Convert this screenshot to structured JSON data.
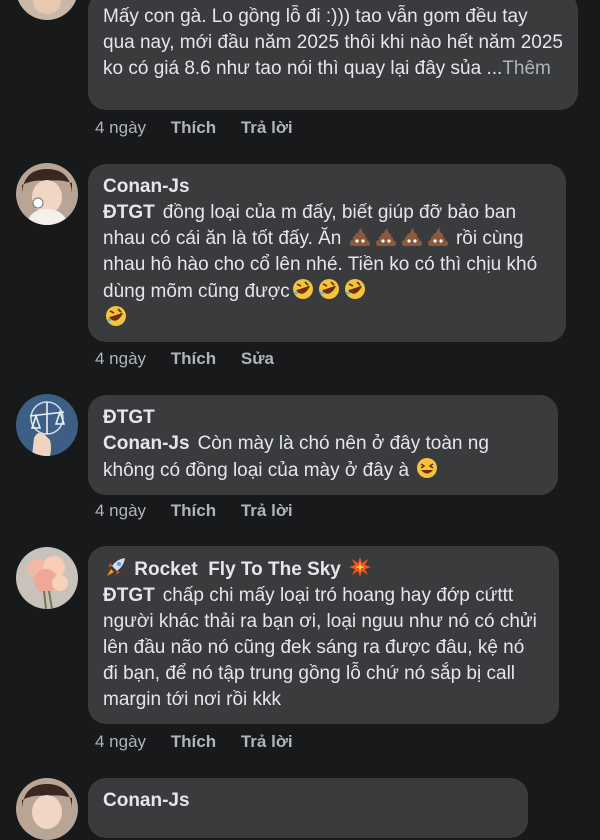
{
  "comments": [
    {
      "text": "Mấy con gà. Lo gồng lỗ đi :))) tao vẫn gom đều tay qua nay, mới đầu năm 2025 thôi khi nào hết năm 2025 ko có giá 8.6 như tao nói thì quay lại đây sủa ...",
      "see_more": "Thêm",
      "time": "4 ngày",
      "like": "Thích",
      "reply": "Trả lời"
    },
    {
      "author": "Conan-Js",
      "mention": "ĐTGT",
      "text_1": "đồng loại của m đấy, biết giúp đỡ bảo ban nhau có cái ăn là tốt đấy. Ăn",
      "text_2": "rồi cùng nhau hô hào cho cổ lên nhé. Tiền ko có thì chịu khó dùng mõm cũng được",
      "time": "4 ngày",
      "like": "Thích",
      "edit": "Sửa"
    },
    {
      "author": "ĐTGT",
      "mention": "Conan-Js",
      "text": "Còn mày là chó nên ở đây toàn ng không có đồng loại của mày ở đây à",
      "time": "4 ngày",
      "like": "Thích",
      "reply": "Trả lời"
    },
    {
      "author": "Rocket  Fly To The Sky",
      "mention": "ĐTGT",
      "text": "chấp chi mấy loại tró hoang hay đớp cứttt người khác thải ra bạn ơi, loại nguu như nó có chửi lên đầu não nó cũng đek sáng ra được đâu, kệ nó đi bạn, để nó tập trung gồng lỗ chứ nó sắp bị call margin tới nơi rồi kkk",
      "time": "4 ngày",
      "like": "Thích",
      "reply": "Trả lời"
    },
    {
      "author": "Conan-Js"
    }
  ],
  "icons": [
    "poo-emoji",
    "rofl-emoji",
    "grin-squint-emoji",
    "rocket-emoji",
    "collision-emoji"
  ],
  "colors": {
    "background": "#18191a",
    "bubble": "#3a3b3c",
    "text": "#e4e6eb",
    "secondary_text": "#b0b3b8"
  }
}
